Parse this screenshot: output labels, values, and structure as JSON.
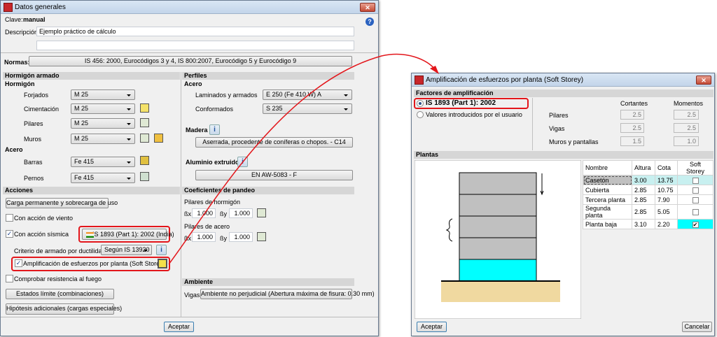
{
  "left_window": {
    "title": "Datos generales",
    "clave_label": "Clave:",
    "clave_value": "manual",
    "descripcion_label": "Descripción:",
    "descripcion_value": "Ejemplo práctico de cálculo",
    "descripcion_value2": "",
    "normas_label": "Normas:",
    "normas_button": "IS 456: 2000, Eurocódigos 3 y 4, IS 800:2007, Eurocódigo 5 y Eurocódigo 9",
    "hormigon_armado": {
      "header": "Hormigón armado",
      "hormigon": "Hormigón",
      "rows": [
        {
          "label": "Forjados",
          "value": "M 25"
        },
        {
          "label": "Cimentación",
          "value": "M 25"
        },
        {
          "label": "Pilares",
          "value": "M 25"
        },
        {
          "label": "Muros",
          "value": "M 25"
        }
      ],
      "acero": "Acero",
      "acero_rows": [
        {
          "label": "Barras",
          "value": "Fe 415"
        },
        {
          "label": "Pernos",
          "value": "Fe 415"
        }
      ]
    },
    "perfiles": {
      "header": "Perfiles",
      "acero": "Acero",
      "rows": [
        {
          "label": "Laminados y armados",
          "value": "E 250 (Fe 410 W) A"
        },
        {
          "label": "Conformados",
          "value": "S 235"
        }
      ],
      "madera": "Madera",
      "madera_button": "Aserrada, procedente de coníferas o chopos. - C14",
      "aluminio": "Aluminio extruido",
      "aluminio_button": "EN AW-5083 - F"
    },
    "acciones": {
      "header": "Acciones",
      "carga_button": "Carga permanente y sobrecarga de uso",
      "viento": {
        "label": "Con acción de viento",
        "checked": false
      },
      "sismica": {
        "label": "Con acción sísmica",
        "checked": true,
        "button": "IS 1893 (Part 1): 2002 (India)"
      },
      "criterio_label": "Criterio de armado por ductilidad",
      "criterio_value": "Según IS 13920",
      "amplificacion": {
        "label": "Amplificación de esfuerzos por planta (Soft Storey)",
        "checked": true
      },
      "fuego": {
        "label": "Comprobar resistencia al fuego",
        "checked": false
      },
      "estados_button": "Estados límite (combinaciones)",
      "hipotesis_button": "Hipótesis adicionales (cargas especiales)"
    },
    "pandeo": {
      "header": "Coeficientes de pandeo",
      "hormigon_label": "Pilares de hormigón",
      "hx_label": "ßx",
      "hx": "1.000",
      "hy_label": "ßy",
      "hy": "1.000",
      "acero_label": "Pilares de acero",
      "ax_label": "ßx",
      "ax": "1.000",
      "ay_label": "ßy",
      "ay": "1.000"
    },
    "ambiente": {
      "header": "Ambiente",
      "vigas_label": "Vigas",
      "vigas_button": "Ambiente no perjudicial (Abertura máxima de fisura: 0.30 mm)"
    },
    "accept": "Aceptar",
    "help": "?",
    "close": "✕"
  },
  "right_window": {
    "title": "Amplificación de esfuerzos por planta (Soft Storey)",
    "factores_header": "Factores de amplificación",
    "radio_is": "IS 1893 (Part 1): 2002",
    "radio_user": "Valores introducidos por el usuario",
    "col_cortantes": "Cortantes",
    "col_momentos": "Momentos",
    "factors": [
      {
        "label": "Pilares",
        "cortantes": "2.5",
        "momentos": "2.5"
      },
      {
        "label": "Vigas",
        "cortantes": "2.5",
        "momentos": "2.5"
      },
      {
        "label": "Muros y pantallas",
        "cortantes": "1.5",
        "momentos": "1.0"
      }
    ],
    "plantas_header": "Plantas",
    "table_headers": [
      "Nombre",
      "Altura",
      "Cota",
      "Soft Storey"
    ],
    "rows": [
      {
        "nombre": "Casetón",
        "altura": "3.00",
        "cota": "13.75",
        "soft": false
      },
      {
        "nombre": "Cubierta",
        "altura": "2.85",
        "cota": "10.75",
        "soft": false
      },
      {
        "nombre": "Tercera planta",
        "altura": "2.85",
        "cota": "7.90",
        "soft": false
      },
      {
        "nombre": "Segunda planta",
        "altura": "2.85",
        "cota": "5.05",
        "soft": false
      },
      {
        "nombre": "Planta baja",
        "altura": "3.10",
        "cota": "2.20",
        "soft": true
      }
    ],
    "accept": "Aceptar",
    "cancel": "Cancelar",
    "close": "✕"
  },
  "colors": {
    "highlight_red": "#e3161b",
    "soft_storey_cyan": "#00ffff",
    "selected_row": "#c8f0f0"
  }
}
